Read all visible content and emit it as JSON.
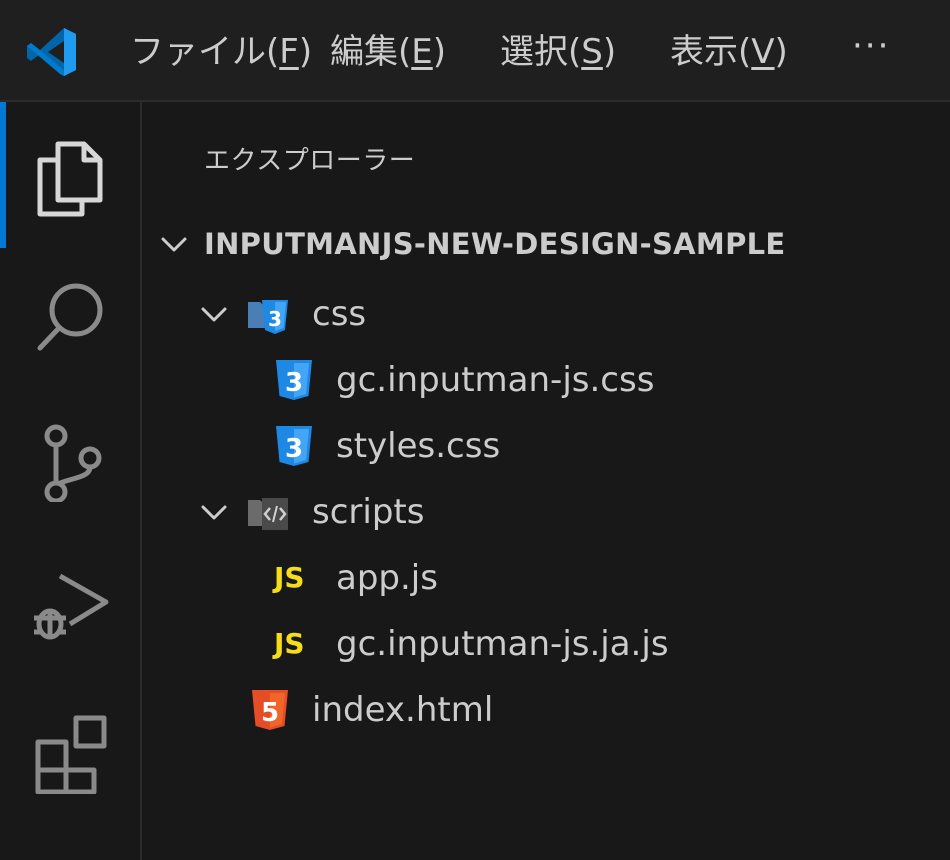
{
  "menu": {
    "items": [
      {
        "name": "file",
        "text": "ファイル(",
        "mnemonic": "F",
        "close": ")"
      },
      {
        "name": "edit",
        "text": "編集(",
        "mnemonic": "E",
        "close": ")"
      },
      {
        "name": "selection",
        "text": "選択(",
        "mnemonic": "S",
        "close": ")"
      },
      {
        "name": "view",
        "text": "表示(",
        "mnemonic": "V",
        "close": ")"
      }
    ],
    "more": "···"
  },
  "sidebar": {
    "title": "エクスプローラー",
    "root": "INPUTMANJS-NEW-DESIGN-SAMPLE",
    "tree": [
      {
        "label": "css",
        "type": "folder",
        "icon": "css-folder-icon",
        "expanded": true
      },
      {
        "label": "gc.inputman-js.css",
        "type": "file",
        "icon": "css-file-icon"
      },
      {
        "label": "styles.css",
        "type": "file",
        "icon": "css-file-icon"
      },
      {
        "label": "scripts",
        "type": "folder",
        "icon": "scripts-folder-icon",
        "expanded": true
      },
      {
        "label": "app.js",
        "type": "file",
        "icon": "js-file-icon",
        "badge": "JS"
      },
      {
        "label": "gc.inputman-js.ja.js",
        "type": "file",
        "icon": "js-file-icon",
        "badge": "JS"
      },
      {
        "label": "index.html",
        "type": "file",
        "icon": "html-file-icon"
      }
    ]
  },
  "colors": {
    "accent": "#0078d4",
    "css_blue": "#42a5f5",
    "js_yellow": "#f5de19",
    "html_orange": "#e44d26"
  }
}
